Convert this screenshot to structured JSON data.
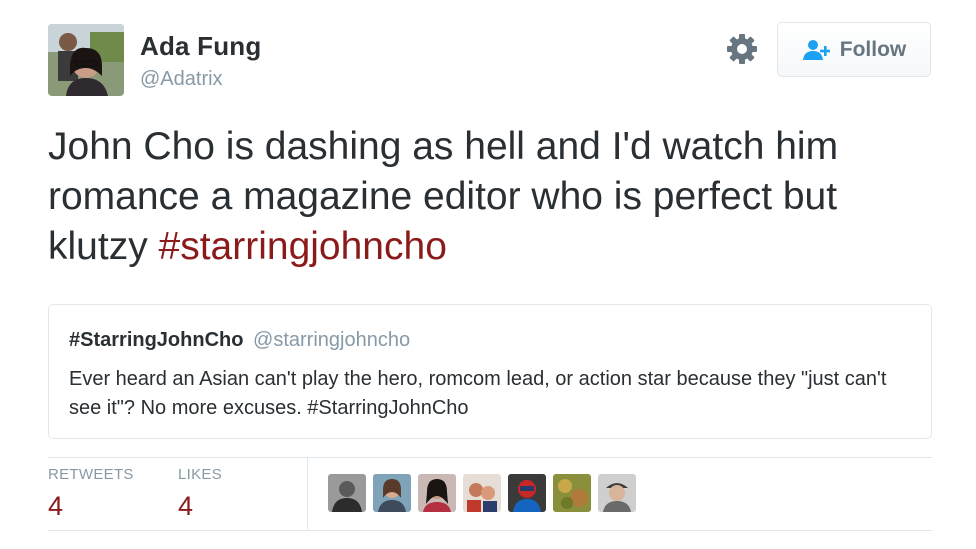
{
  "author": {
    "display_name": "Ada Fung",
    "handle": "@Adatrix",
    "avatar_icon": "profile-photo"
  },
  "actions": {
    "settings_icon": "gear-icon",
    "follow_label": "Follow",
    "follow_icon": "add-user-icon"
  },
  "tweet": {
    "text": "John Cho is dashing as hell and I'd watch him romance a magazine editor who is perfect but klutzy ",
    "hashtag": "#starringjohncho"
  },
  "quoted_tweet": {
    "name": "#StarringJohnCho",
    "handle": "@starringjohncho",
    "text": "Ever heard an Asian can't play the hero, romcom lead, or action star because they \"just can't see it\"? No more excuses. #StarringJohnCho"
  },
  "stats": {
    "retweets_label": "RETWEETS",
    "retweets_count": "4",
    "likes_label": "LIKES",
    "likes_count": "4"
  },
  "likers_avatars": [
    "liker-avatar-1",
    "liker-avatar-2",
    "liker-avatar-3",
    "liker-avatar-4",
    "liker-avatar-5",
    "liker-avatar-6",
    "liker-avatar-7"
  ],
  "colors": {
    "hashtag": "#8b1a1a",
    "secondary_text": "#8899a6",
    "border": "#e1e8ed",
    "primary_text": "#292f33"
  }
}
